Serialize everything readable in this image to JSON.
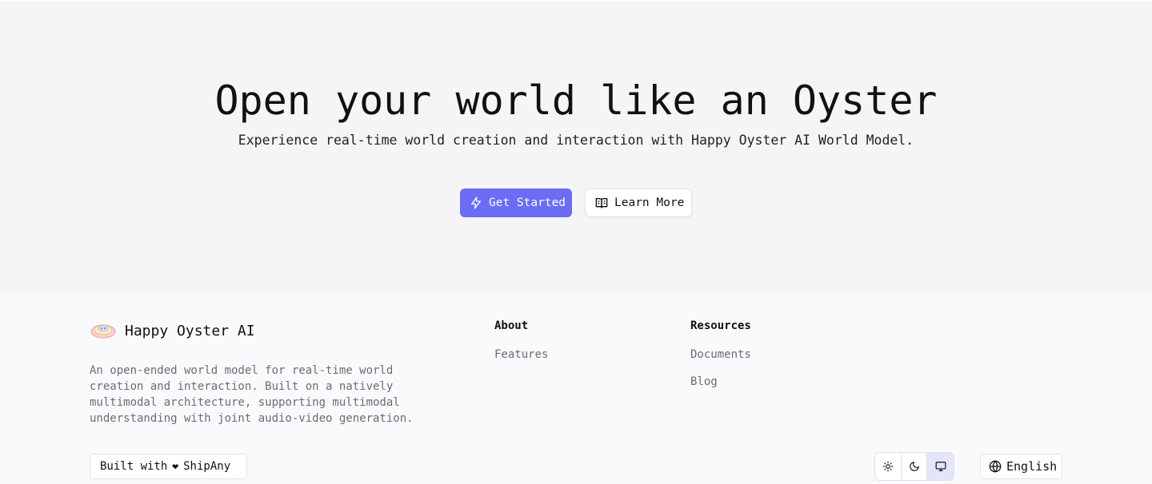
{
  "hero": {
    "title": "Open your world like an Oyster",
    "subtitle": "Experience real-time world creation and interaction with Happy Oyster AI World Model.",
    "primary_button": {
      "label": "Get Started",
      "icon": "lightning-icon"
    },
    "secondary_button": {
      "label": "Learn More",
      "icon": "book-open-icon"
    }
  },
  "footer": {
    "brand": {
      "name": "Happy Oyster AI",
      "description": "An open-ended world model for real-time world creation and interaction. Built on a natively multimodal architecture, supporting multimodal understanding with joint audio-video generation."
    },
    "columns": [
      {
        "title": "About",
        "links": [
          "Features"
        ]
      },
      {
        "title": "Resources",
        "links": [
          "Documents",
          "Blog"
        ]
      }
    ],
    "built_with": {
      "prefix": "Built with",
      "heart": "❤",
      "name": "ShipAny"
    },
    "theme": {
      "options": [
        "light",
        "dark",
        "system"
      ],
      "selected": "system"
    },
    "language": {
      "label": "English",
      "icon": "globe-icon"
    }
  },
  "colors": {
    "accent": "#6c6cf5",
    "hero_bg": "#f5f5f7",
    "footer_bg": "#fafafc",
    "muted_text": "#6b6b74",
    "theme_active_bg": "#e3e6fb"
  }
}
